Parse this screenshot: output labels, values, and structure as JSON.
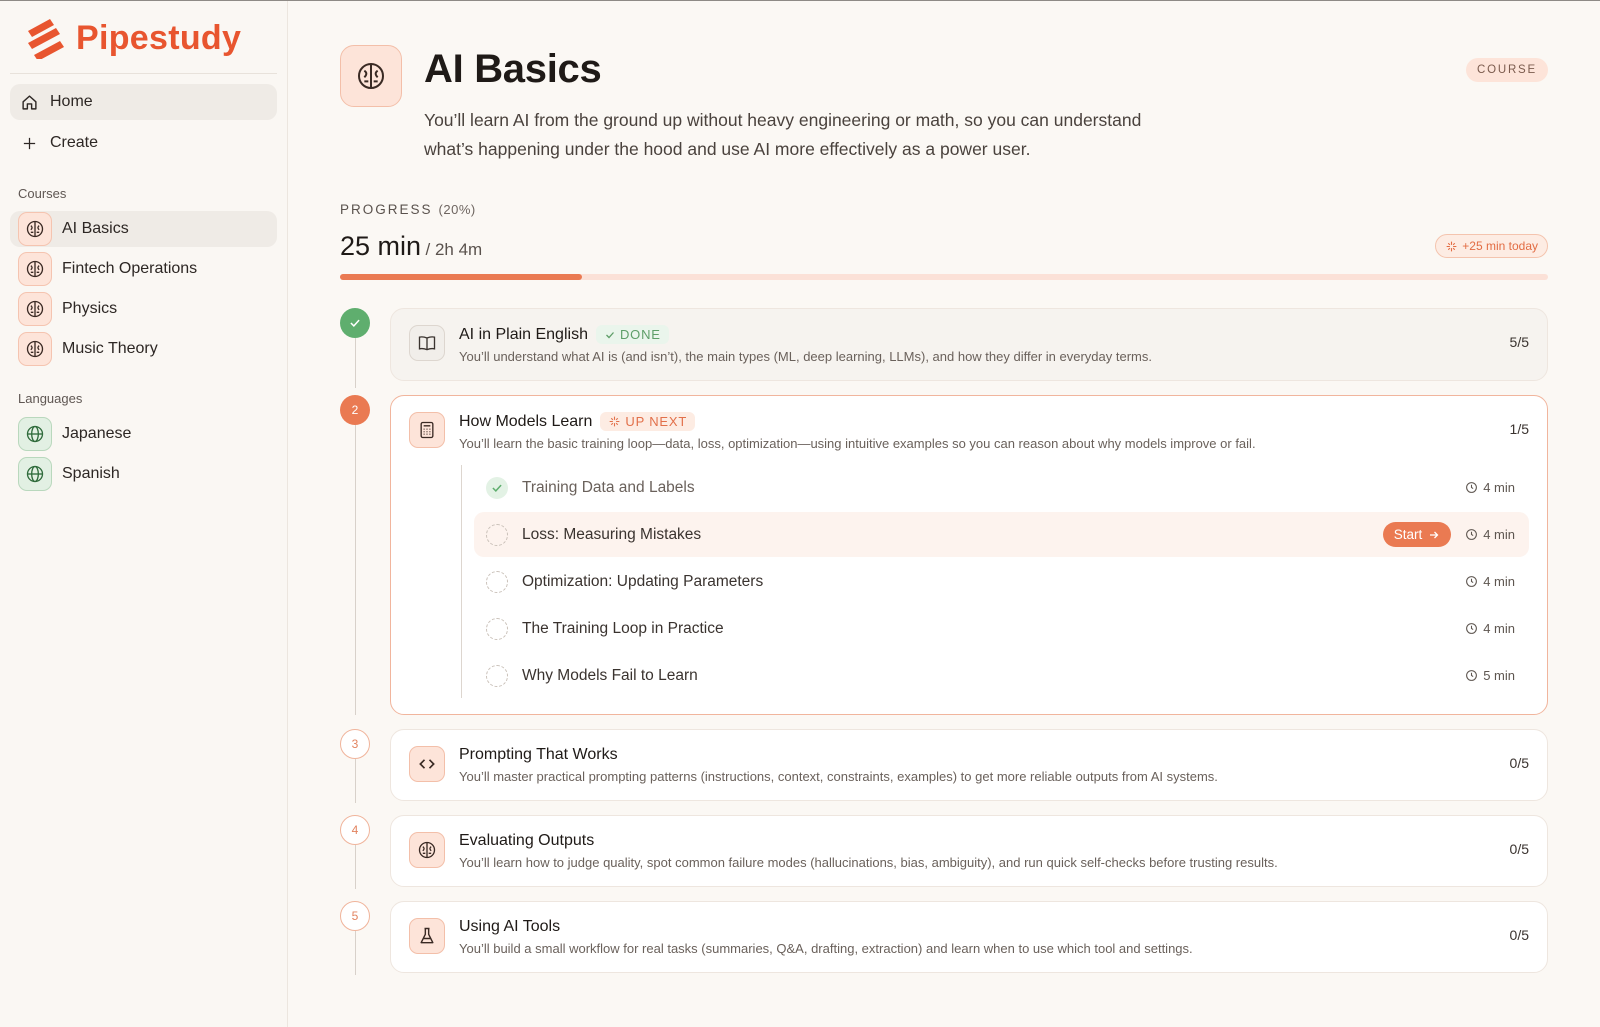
{
  "brand": {
    "name": "Pipestudy",
    "color": "#e8552f"
  },
  "nav": {
    "home": "Home",
    "create": "Create"
  },
  "sidebar": {
    "courses_label": "Courses",
    "courses": [
      {
        "label": "AI Basics",
        "icon": "brain-icon",
        "active": true
      },
      {
        "label": "Fintech Operations",
        "icon": "brain-icon"
      },
      {
        "label": "Physics",
        "icon": "brain-icon"
      },
      {
        "label": "Music Theory",
        "icon": "brain-icon"
      }
    ],
    "languages_label": "Languages",
    "languages": [
      {
        "label": "Japanese",
        "icon": "globe-icon"
      },
      {
        "label": "Spanish",
        "icon": "globe-icon"
      }
    ]
  },
  "course": {
    "title": "AI Basics",
    "badge": "COURSE",
    "description": "You’ll learn AI from the ground up without heavy engineering or math, so you can understand what’s happening under the hood and use AI more effectively as a power user.",
    "progress_label": "PROGRESS",
    "progress_pct_text": "(20%)",
    "progress_fraction": 0.2,
    "time_done": "25 min",
    "time_total": "/ 2h 4m",
    "today_chip": "+25 min today"
  },
  "units": [
    {
      "marker": "",
      "state": "done",
      "icon": "book-icon",
      "title": "AI in Plain English",
      "tag": "DONE",
      "description": "You’ll understand what AI is (and isn’t), the main types (ML, deep learning, LLMs), and how they differ in everyday terms.",
      "count": "5/5"
    },
    {
      "marker": "2",
      "state": "current",
      "icon": "calculator-icon",
      "title": "How Models Learn",
      "tag": "UP NEXT",
      "description": "You’ll learn the basic training loop—data, loss, optimization—using intuitive examples so you can reason about why models improve or fail.",
      "count": "1/5",
      "lessons": [
        {
          "title": "Training Data and Labels",
          "time": "4 min",
          "done": true
        },
        {
          "title": "Loss: Measuring Mistakes",
          "time": "4 min",
          "active": true,
          "action": "Start"
        },
        {
          "title": "Optimization: Updating Parameters",
          "time": "4 min"
        },
        {
          "title": "The Training Loop in Practice",
          "time": "4 min"
        },
        {
          "title": "Why Models Fail to Learn",
          "time": "5 min"
        }
      ]
    },
    {
      "marker": "3",
      "state": "todo",
      "icon": "code-icon",
      "title": "Prompting That Works",
      "description": "You’ll master practical prompting patterns (instructions, context, constraints, examples) to get more reliable outputs from AI systems.",
      "count": "0/5"
    },
    {
      "marker": "4",
      "state": "todo",
      "icon": "brain-icon",
      "title": "Evaluating Outputs",
      "description": "You’ll learn how to judge quality, spot common failure modes (hallucinations, bias, ambiguity), and run quick self-checks before trusting results.",
      "count": "0/5"
    },
    {
      "marker": "5",
      "state": "todo",
      "icon": "flask-icon",
      "title": "Using AI Tools",
      "description": "You’ll build a small workflow for real tasks (summaries, Q&A, drafting, extraction) and learn when to use which tool and settings.",
      "count": "0/5"
    }
  ],
  "colors": {
    "accent": "#ea7a52",
    "success": "#5fae6e",
    "background": "#fbf8f4"
  }
}
